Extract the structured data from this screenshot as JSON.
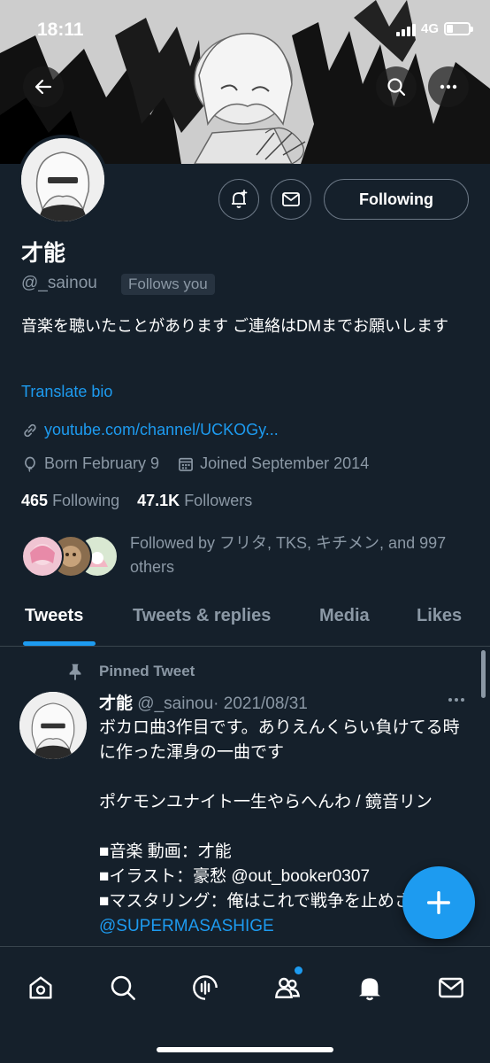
{
  "status_bar": {
    "time": "18:11",
    "network": "4G"
  },
  "header": {
    "back_icon": "arrow-left-icon",
    "search_icon": "search-icon",
    "more_icon": "more-dots-icon"
  },
  "profile": {
    "name": "才能",
    "handle": "@_sainou",
    "follows_you": "Follows you",
    "bio": "音楽を聴いたことがあります ご連絡はDMまでお願いします",
    "translate_bio": "Translate bio",
    "link": "youtube.com/channel/UCKOGy...",
    "birthday": "Born February 9",
    "joined": "Joined September 2014",
    "following_count": "465",
    "following_label": "Following",
    "followers_count": "47.1K",
    "followers_label": "Followers",
    "followed_by": "Followed by フリタ, TKS, キチメン, and 997 others"
  },
  "actions": {
    "following_button": "Following",
    "notify_icon": "bell-plus-icon",
    "message_icon": "envelope-icon"
  },
  "tabs": [
    {
      "label": "Tweets",
      "active": true
    },
    {
      "label": "Tweets & replies",
      "active": false
    },
    {
      "label": "Media",
      "active": false
    },
    {
      "label": "Likes",
      "active": false
    }
  ],
  "tweet": {
    "pinned_label": "Pinned Tweet",
    "name": "才能",
    "handle": "@_sainou",
    "date": "· 2021/08/31",
    "body": "ボカロ曲3作目です。ありえんくらい負けてる時に作った渾身の一曲です\n\nポケモンユナイト一生やらへんわ / 鏡音リン\n\n■音楽 動画：才能\n■イラスト：豪愁 @out_booker0307\n■マスタリング：俺はこれで戦争を止めさせる。",
    "mention_last": "@SUPERMASASHIGE"
  },
  "fab_icon": "plus-icon",
  "bottom_nav": [
    "home-icon",
    "search-icon",
    "spaces-icon",
    "communities-icon",
    "notifications-icon",
    "messages-icon"
  ],
  "colors": {
    "background": "#15202b",
    "accent": "#1d9bf0",
    "secondary_text": "#8b98a5",
    "divider": "#38444d"
  }
}
